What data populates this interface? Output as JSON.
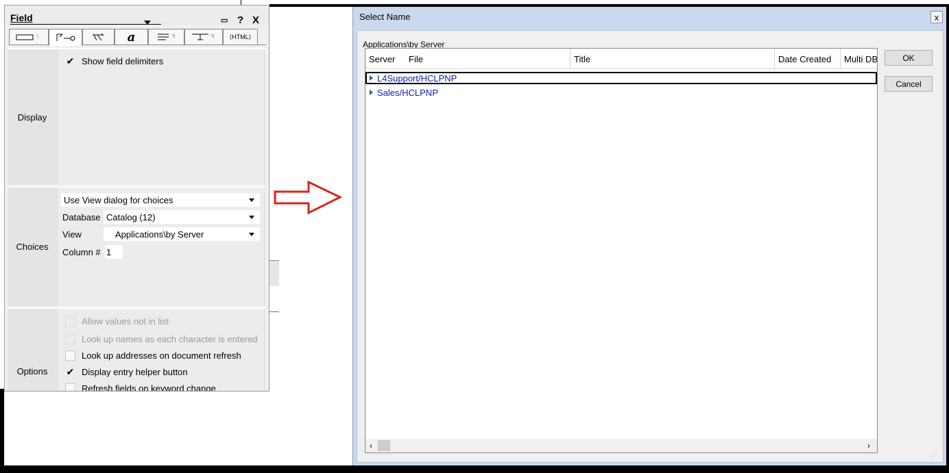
{
  "field_panel": {
    "title": "Field",
    "controls": {
      "restore": "▭",
      "help": "?",
      "close": "X"
    },
    "tabs": [
      {
        "label": "",
        "icon": "field-info-icon"
      },
      {
        "label": "",
        "icon": "control-icon"
      },
      {
        "label": "",
        "icon": "advanced-icon"
      },
      {
        "label": "a",
        "icon": "font-icon"
      },
      {
        "label": "",
        "icon": "paragraph-icon"
      },
      {
        "label": "",
        "icon": "hide-when-icon"
      },
      {
        "label": "⟨HTML⟩",
        "icon": "html-icon"
      }
    ],
    "display": {
      "label": "Display",
      "show_delimiters": {
        "label": "Show field delimiters",
        "checked": true
      }
    },
    "choices": {
      "label": "Choices",
      "method": "Use View dialog for choices",
      "database_label": "Database",
      "database_value": "Catalog (12)",
      "view_label": "View",
      "view_value": "Applications\\by Server",
      "column_label": "Column #",
      "column_value": "1"
    },
    "options": {
      "label": "Options",
      "items": [
        {
          "label": "Allow values not in list",
          "checked": false,
          "disabled": true
        },
        {
          "label": "Look up names as each character is entered",
          "checked": false,
          "disabled": true
        },
        {
          "label": "Look up addresses on document refresh",
          "checked": false,
          "disabled": false
        },
        {
          "label": "Display entry helper button",
          "checked": true,
          "disabled": false
        },
        {
          "label": "Refresh fields on keyword change",
          "checked": false,
          "disabled": false
        }
      ]
    }
  },
  "arrow": {
    "color": "#d9261c"
  },
  "dialog": {
    "title": "Select Name",
    "close": "x",
    "view_name": "Applications\\by Server",
    "columns": [
      "Server",
      "File",
      "Title",
      "Date Created",
      "Multi DB"
    ],
    "rows": [
      "L4Support/HCLPNP",
      "Sales/HCLPNP"
    ],
    "buttons": {
      "ok": "OK",
      "cancel": "Cancel"
    },
    "scroll": {
      "left": "‹",
      "right": "›"
    }
  }
}
